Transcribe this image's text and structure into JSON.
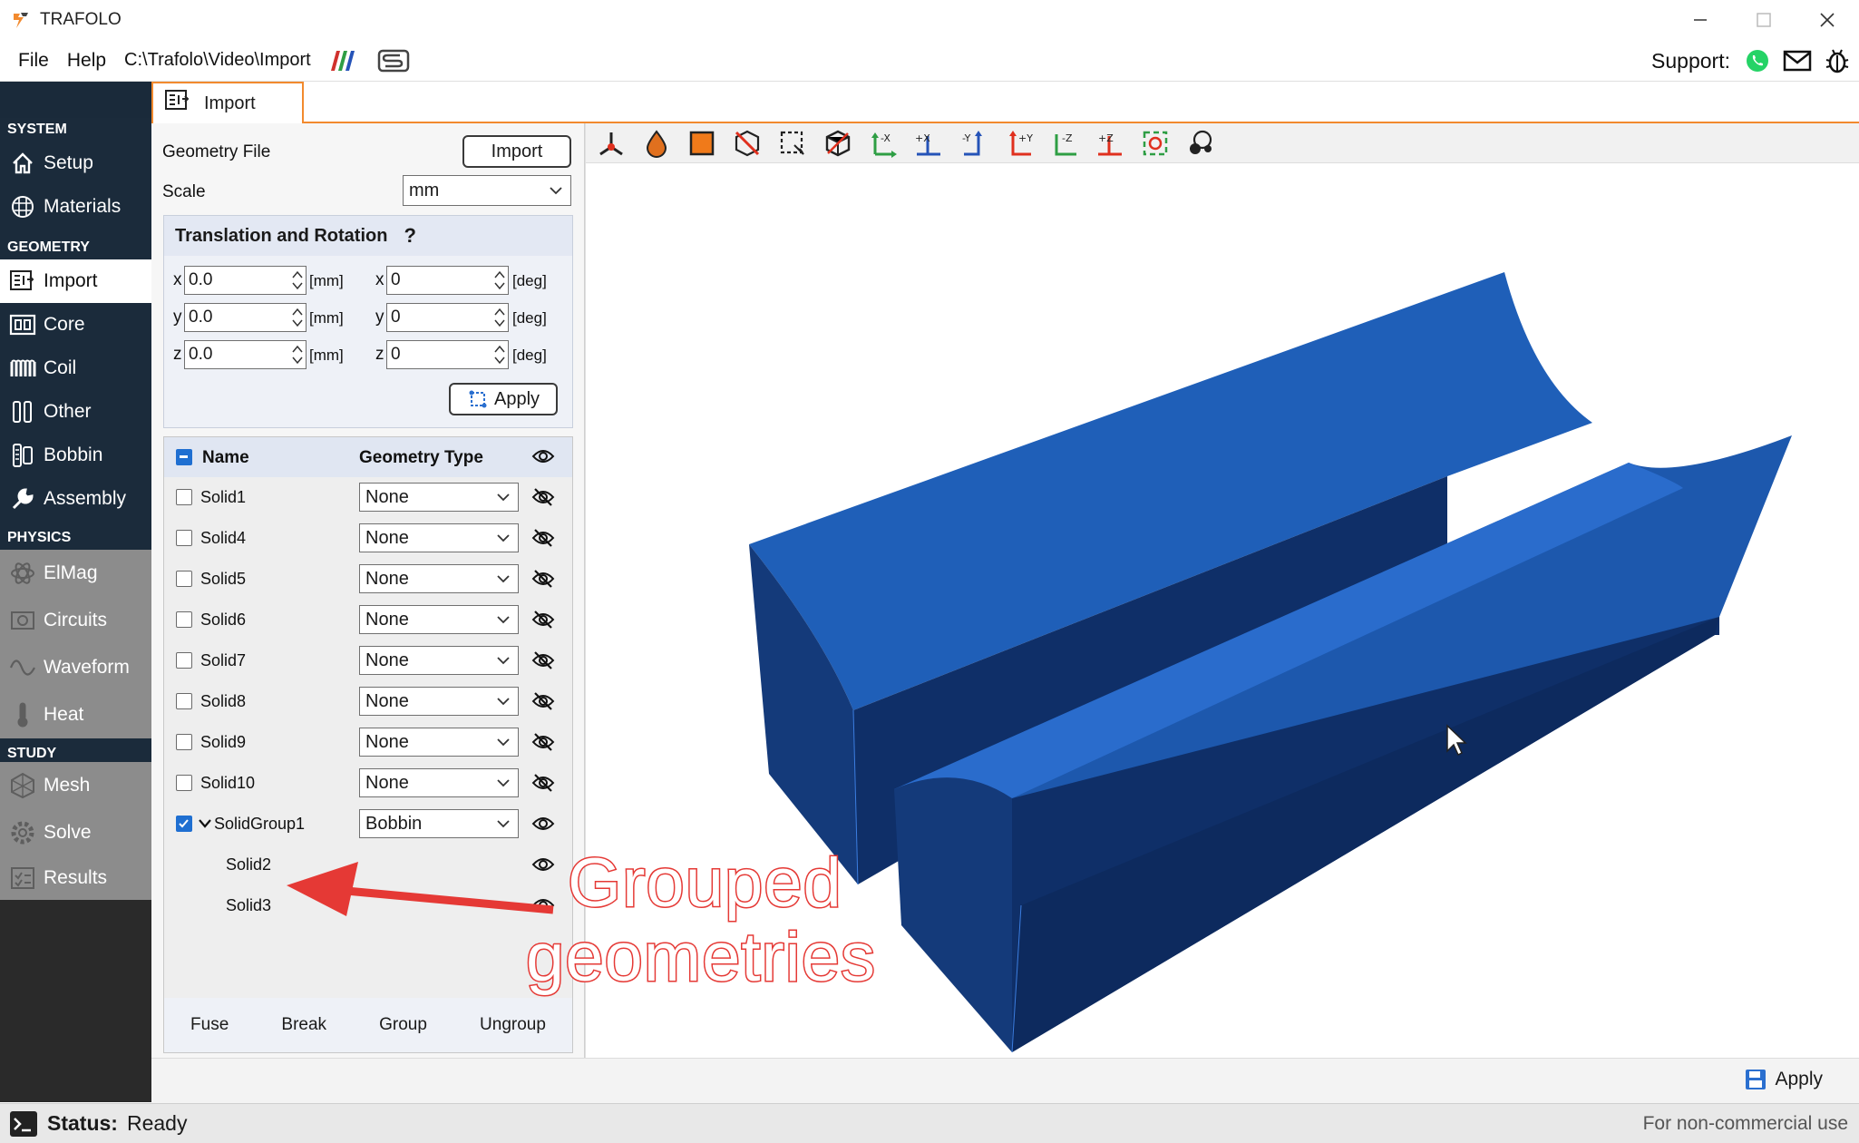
{
  "window": {
    "title": "TRAFOLO",
    "controls": [
      "minimize",
      "maximize",
      "close"
    ]
  },
  "menubar": {
    "items": [
      "File",
      "Help"
    ],
    "path": "C:\\Trafolo\\Video\\Import",
    "support_label": "Support:"
  },
  "sidebar": {
    "sections": [
      {
        "title": "SYSTEM",
        "items": [
          {
            "label": "Setup",
            "icon": "home-icon"
          },
          {
            "label": "Materials",
            "icon": "materials-icon"
          }
        ]
      },
      {
        "title": "GEOMETRY",
        "items": [
          {
            "label": "Import",
            "icon": "import-icon",
            "active": true
          },
          {
            "label": "Core",
            "icon": "core-icon"
          },
          {
            "label": "Coil",
            "icon": "coil-icon"
          },
          {
            "label": "Other",
            "icon": "other-icon"
          },
          {
            "label": "Bobbin",
            "icon": "bobbin-icon"
          },
          {
            "label": "Assembly",
            "icon": "wrench-icon"
          }
        ]
      },
      {
        "title": "PHYSICS",
        "items": [
          {
            "label": "ElMag",
            "icon": "atom-icon",
            "disabled": true
          },
          {
            "label": "Circuits",
            "icon": "circuits-icon",
            "disabled": true
          },
          {
            "label": "Waveform",
            "icon": "waveform-icon",
            "disabled": true
          },
          {
            "label": "Heat",
            "icon": "thermometer-icon",
            "disabled": true
          }
        ]
      },
      {
        "title": "STUDY",
        "items": [
          {
            "label": "Mesh",
            "icon": "mesh-icon",
            "disabled": true
          },
          {
            "label": "Solve",
            "icon": "solve-icon",
            "disabled": true
          },
          {
            "label": "Results",
            "icon": "results-icon",
            "disabled": true
          }
        ]
      }
    ]
  },
  "tab": {
    "label": "Import"
  },
  "panel": {
    "geometry_file_label": "Geometry File",
    "import_button": "Import",
    "scale_label": "Scale",
    "scale_value": "mm",
    "translation": {
      "title": "Translation and Rotation",
      "help": "?",
      "rows": [
        {
          "axis": "x",
          "value": "0.0",
          "unit": "[mm]",
          "rot_axis": "x",
          "rot_value": "0",
          "rot_unit": "[deg]"
        },
        {
          "axis": "y",
          "value": "0.0",
          "unit": "[mm]",
          "rot_axis": "y",
          "rot_value": "0",
          "rot_unit": "[deg]"
        },
        {
          "axis": "z",
          "value": "0.0",
          "unit": "[mm]",
          "rot_axis": "z",
          "rot_value": "0",
          "rot_unit": "[deg]"
        }
      ],
      "apply_button": "Apply"
    },
    "geometry_table": {
      "col_name": "Name",
      "col_type": "Geometry Type",
      "rows": [
        {
          "name": "Solid1",
          "type": "None",
          "visible": false,
          "checked": false
        },
        {
          "name": "Solid4",
          "type": "None",
          "visible": false,
          "checked": false
        },
        {
          "name": "Solid5",
          "type": "None",
          "visible": false,
          "checked": false
        },
        {
          "name": "Solid6",
          "type": "None",
          "visible": false,
          "checked": false
        },
        {
          "name": "Solid7",
          "type": "None",
          "visible": false,
          "checked": false
        },
        {
          "name": "Solid8",
          "type": "None",
          "visible": false,
          "checked": false
        },
        {
          "name": "Solid9",
          "type": "None",
          "visible": false,
          "checked": false
        },
        {
          "name": "Solid10",
          "type": "None",
          "visible": false,
          "checked": false
        },
        {
          "name": "SolidGroup1",
          "type": "Bobbin",
          "visible": true,
          "checked": true,
          "expanded": true
        },
        {
          "name": "Solid2",
          "child": true,
          "visible": true
        },
        {
          "name": "Solid3",
          "child": true,
          "visible": true
        }
      ],
      "actions": [
        "Fuse",
        "Break",
        "Group",
        "Ungroup"
      ]
    }
  },
  "annotation": {
    "line1": "Grouped",
    "line2": "geometries",
    "color": "#e53935"
  },
  "model_color": "#1f5fb8",
  "bottom": {
    "apply_button": "Apply"
  },
  "status": {
    "label": "Status:",
    "value": "Ready",
    "license": "For non-commercial use"
  }
}
